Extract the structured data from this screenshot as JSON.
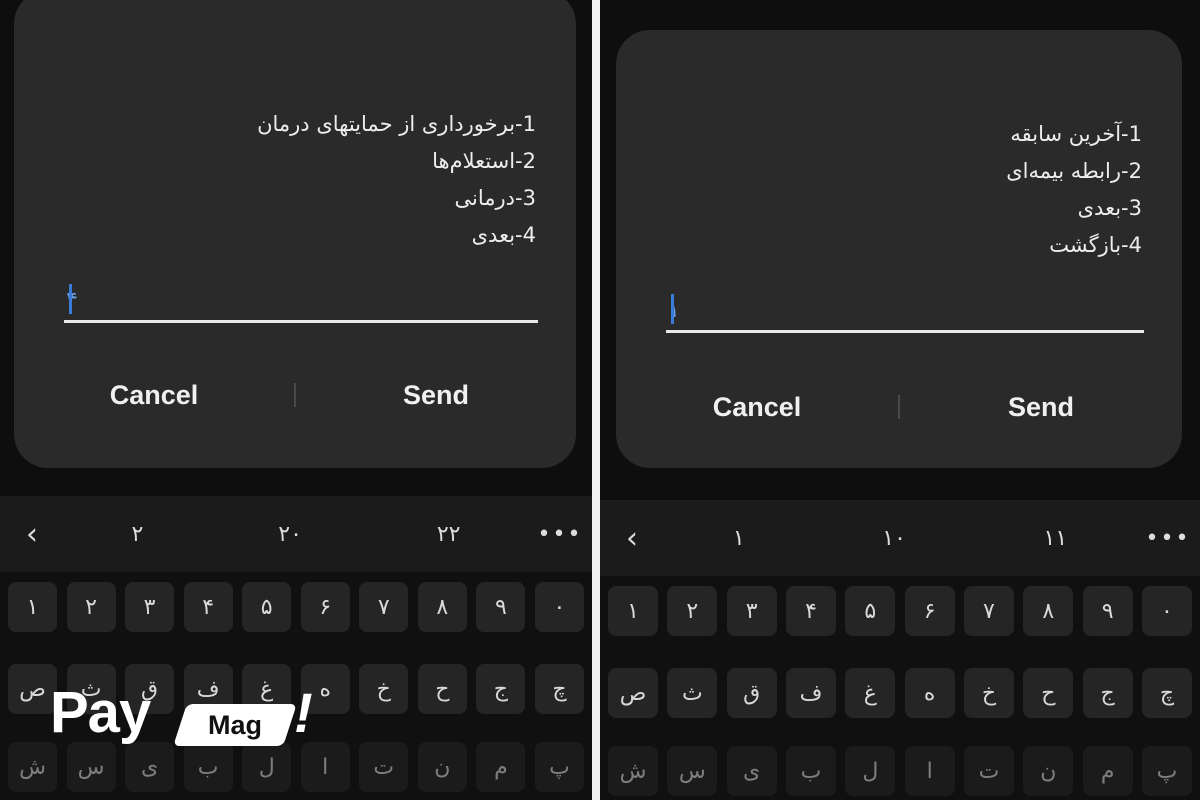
{
  "left": {
    "menu": [
      "1-برخورداری از حمایتهای درمان",
      "2-استعلام‌ها",
      "3-درمانی",
      "4-بعدی"
    ],
    "input_value": "۴",
    "cancel_label": "Cancel",
    "send_label": "Send",
    "suggestions": [
      "۲",
      "۲۰",
      "۲۲"
    ],
    "keys_row1": [
      "۱",
      "۲",
      "۳",
      "۴",
      "۵",
      "۶",
      "۷",
      "۸",
      "۹",
      "۰"
    ],
    "keys_row2": [
      "ص",
      "ث",
      "ق",
      "ف",
      "غ",
      "ه",
      "خ",
      "ح",
      "ج",
      "چ"
    ],
    "keys_row3": [
      "ش",
      "س",
      "ی",
      "ب",
      "ل",
      "ا",
      "ت",
      "ن",
      "م",
      "پ"
    ]
  },
  "right": {
    "menu": [
      "1-آخرین سابقه",
      "2-رابطه بیمه‌ای",
      "3-بعدی",
      "4-بازگشت"
    ],
    "input_value": "۱",
    "cancel_label": "Cancel",
    "send_label": "Send",
    "suggestions": [
      "۱",
      "۱۰",
      "۱۱"
    ],
    "keys_row1": [
      "۱",
      "۲",
      "۳",
      "۴",
      "۵",
      "۶",
      "۷",
      "۸",
      "۹",
      "۰"
    ],
    "keys_row2": [
      "ص",
      "ث",
      "ق",
      "ف",
      "غ",
      "ه",
      "خ",
      "ح",
      "ج",
      "چ"
    ],
    "keys_row3": [
      "ش",
      "س",
      "ی",
      "ب",
      "ل",
      "ا",
      "ت",
      "ن",
      "م",
      "پ"
    ]
  },
  "logo": {
    "pay": "Pay",
    "mag": "Mag",
    "bang": "!"
  },
  "icons": {
    "back": "chevron-left-icon",
    "more": "more-horizontal-icon"
  },
  "colors": {
    "dialog_bg": "#2a2a2b",
    "cursor": "#3b7bd8",
    "key_bg": "#252525"
  }
}
